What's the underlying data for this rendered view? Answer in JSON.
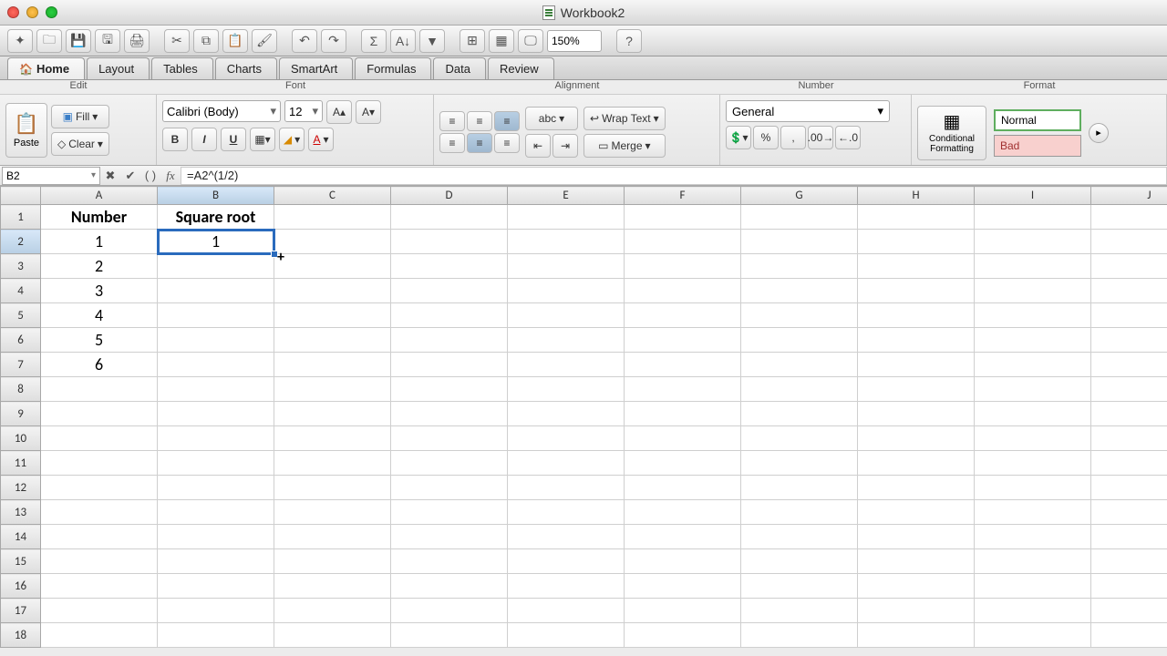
{
  "window": {
    "title": "Workbook2"
  },
  "toolbar": {
    "zoom": "150%"
  },
  "tabs": [
    "Home",
    "Layout",
    "Tables",
    "Charts",
    "SmartArt",
    "Formulas",
    "Data",
    "Review"
  ],
  "ribbon": {
    "groups": {
      "edit": "Edit",
      "font": "Font",
      "alignment": "Alignment",
      "number": "Number",
      "format": "Format"
    },
    "paste": "Paste",
    "fill": "Fill",
    "clear": "Clear",
    "font_name": "Calibri (Body)",
    "font_size": "12",
    "wrap": "Wrap Text",
    "merge": "Merge",
    "orientation": "abc",
    "number_format": "General",
    "conditional": "Conditional Formatting",
    "style_normal": "Normal",
    "style_bad": "Bad"
  },
  "formula_bar": {
    "cell_ref": "B2",
    "formula": "=A2^(1/2)"
  },
  "columns": [
    "A",
    "B",
    "C",
    "D",
    "E",
    "F",
    "G",
    "H",
    "I",
    "J"
  ],
  "rows": 18,
  "headers": {
    "A": "Number",
    "B": "Square root"
  },
  "data": {
    "A": [
      "1",
      "2",
      "3",
      "4",
      "5",
      "6"
    ],
    "B": [
      "1",
      "",
      "",
      "",
      "",
      ""
    ]
  },
  "selection": {
    "cell": "B2",
    "row": 2,
    "col": "B"
  }
}
